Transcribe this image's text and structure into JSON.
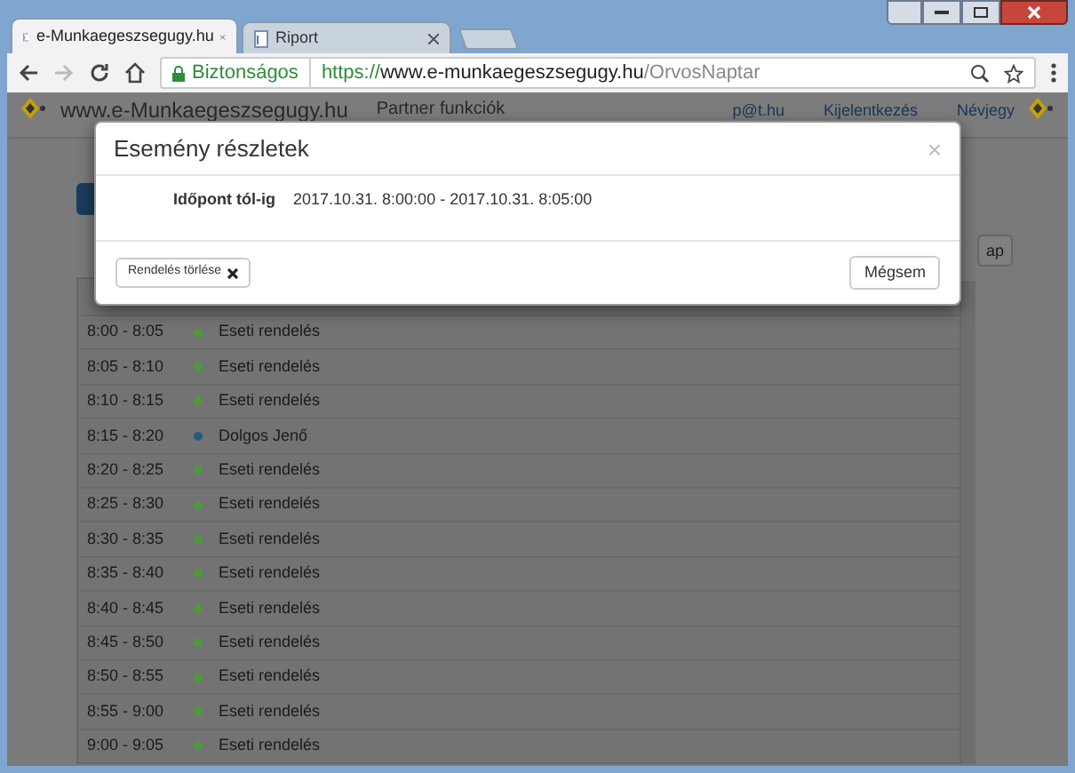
{
  "browser": {
    "tabs": [
      {
        "title": "e-Munkaegeszsegugy.hu",
        "selected": true
      },
      {
        "title": "Riport",
        "selected": false
      }
    ],
    "address": {
      "security": "Biztonságos",
      "scheme": "https://",
      "host": "www.e-munkaegeszsegugy.hu",
      "path": "/OrvosNaptar"
    }
  },
  "header": {
    "site": "www.e-Munkaegeszsegugy.hu",
    "nav": "Partner funkciók",
    "user": "p@t.hu",
    "logout": "Kijelentkezés",
    "about": "Névjegy"
  },
  "toolbar": {
    "right_button": "ap"
  },
  "table": {
    "rows": [
      {
        "time": "8:00 - 8:05",
        "label": "Eseti rendelés",
        "color": "#4e9a3a"
      },
      {
        "time": "8:05 - 8:10",
        "label": "Eseti rendelés",
        "color": "#4e9a3a"
      },
      {
        "time": "8:10 - 8:15",
        "label": "Eseti rendelés",
        "color": "#4e9a3a"
      },
      {
        "time": "8:15 - 8:20",
        "label": "Dolgos Jenő",
        "color": "#1f5b87"
      },
      {
        "time": "8:20 - 8:25",
        "label": "Eseti rendelés",
        "color": "#4e9a3a"
      },
      {
        "time": "8:25 - 8:30",
        "label": "Eseti rendelés",
        "color": "#4e9a3a"
      },
      {
        "time": "8:30 - 8:35",
        "label": "Eseti rendelés",
        "color": "#4e9a3a"
      },
      {
        "time": "8:35 - 8:40",
        "label": "Eseti rendelés",
        "color": "#4e9a3a"
      },
      {
        "time": "8:40 - 8:45",
        "label": "Eseti rendelés",
        "color": "#4e9a3a"
      },
      {
        "time": "8:45 - 8:50",
        "label": "Eseti rendelés",
        "color": "#4e9a3a"
      },
      {
        "time": "8:50 - 8:55",
        "label": "Eseti rendelés",
        "color": "#4e9a3a"
      },
      {
        "time": "8:55 - 9:00",
        "label": "Eseti rendelés",
        "color": "#4e9a3a"
      },
      {
        "time": "9:00 - 9:05",
        "label": "Eseti rendelés",
        "color": "#4e9a3a"
      }
    ]
  },
  "modal": {
    "title": "Esemény részletek",
    "close": "×",
    "field_label": "Időpont tól-ig",
    "field_value": "2017.10.31. 8:00:00 - 2017.10.31. 8:05:00",
    "delete_button": "Rendelés törlése",
    "cancel_button": "Mégsem"
  }
}
